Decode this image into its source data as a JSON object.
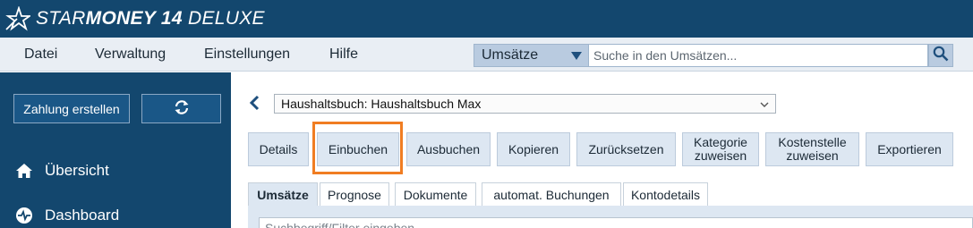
{
  "app": {
    "logo_text_light": "STAR",
    "logo_text_bold": "MONEY 14",
    "logo_text_suffix": " DELUXE",
    "icon": "star-money-logo-icon"
  },
  "menu": {
    "items": [
      "Datei",
      "Verwaltung",
      "Einstellungen",
      "Hilfe"
    ]
  },
  "search": {
    "scope_value": "Umsätze",
    "placeholder": "Suche in den Umsätzen...",
    "button_icon": "search-icon"
  },
  "sidebar": {
    "create_payment_label": "Zahlung erstellen",
    "refresh_icon": "refresh-icon",
    "nav": [
      {
        "label": "Übersicht",
        "icon": "home-icon"
      },
      {
        "label": "Dashboard",
        "icon": "dashboard-icon"
      }
    ]
  },
  "main": {
    "back_icon": "chevron-left-icon",
    "account_selected": "Haushaltsbuch: Haushaltsbuch Max",
    "toolbar": [
      {
        "label": "Details"
      },
      {
        "label": "Einbuchen"
      },
      {
        "label": "Ausbuchen"
      },
      {
        "label": "Kopieren"
      },
      {
        "label": "Zurücksetzen"
      },
      {
        "label": "Kategorie\nzuweisen"
      },
      {
        "label": "Kostenstelle\nzuweisen"
      },
      {
        "label": "Exportieren"
      }
    ],
    "tabs": [
      "Umsätze",
      "Prognose",
      "Dokumente",
      "automat. Buchungen",
      "Kontodetails"
    ],
    "active_tab": "Umsätze",
    "filter_placeholder": "Suchbegriff/Filter eingeben"
  },
  "colors": {
    "header_bg": "#13476e",
    "menubar_bg": "#e9eef4",
    "button_bg": "#dde7f2",
    "highlight": "#f07d22"
  }
}
